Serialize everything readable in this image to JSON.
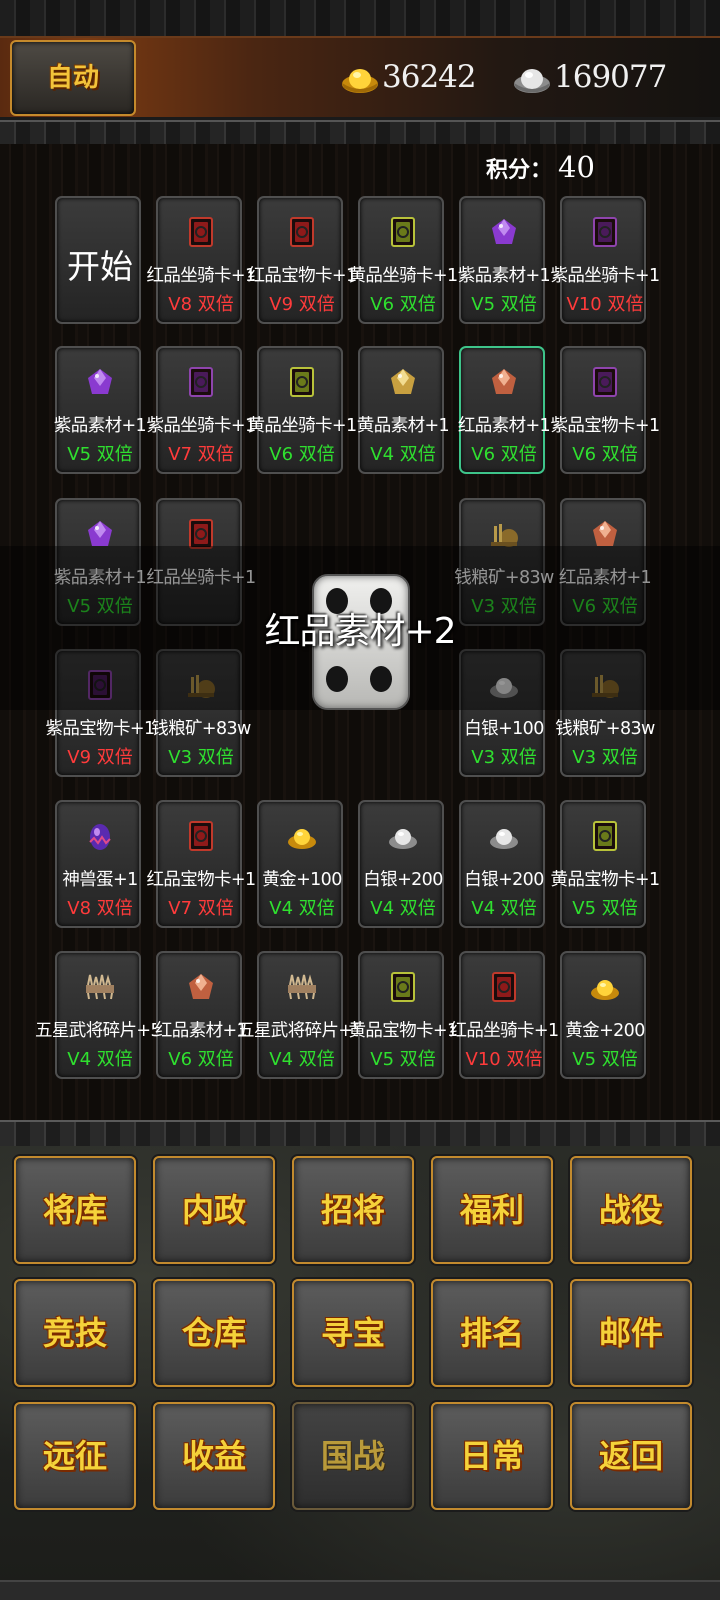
{
  "header": {
    "auto_label": "自动",
    "gold_amount": "36242",
    "silver_amount": "169077",
    "gold_icon": "gold-ingot-icon",
    "silver_icon": "silver-ingot-icon"
  },
  "score": {
    "label": "积分：",
    "value": "40"
  },
  "start_label": "开始",
  "cells": [
    {
      "name": "红品坐骑卡+1",
      "mult": "V8 双倍",
      "color": "#ff3b3b",
      "icon": "red-card"
    },
    {
      "name": "红品宝物卡+1",
      "mult": "V9 双倍",
      "color": "#ff3b3b",
      "icon": "red-card"
    },
    {
      "name": "黄品坐骑卡+1",
      "mult": "V6 双倍",
      "color": "#2fe02f",
      "icon": "yellow-card"
    },
    {
      "name": "紫品素材+1",
      "mult": "V5 双倍",
      "color": "#2fe02f",
      "icon": "purple-gem"
    },
    {
      "name": "紫品坐骑卡+1",
      "mult": "V10 双倍",
      "color": "#ff3b3b",
      "icon": "purple-card"
    },
    {
      "name": "紫品素材+1",
      "mult": "V5 双倍",
      "color": "#2fe02f",
      "icon": "purple-gem"
    },
    {
      "name": "紫品坐骑卡+1",
      "mult": "V7 双倍",
      "color": "#ff3b3b",
      "icon": "purple-card"
    },
    {
      "name": "黄品坐骑卡+1",
      "mult": "V6 双倍",
      "color": "#2fe02f",
      "icon": "yellow-card"
    },
    {
      "name": "黄品素材+1",
      "mult": "V4 双倍",
      "color": "#2fe02f",
      "icon": "yellow-gem"
    },
    {
      "name": "红品素材+1",
      "mult": "V6 双倍",
      "color": "#2fe02f",
      "icon": "red-gem",
      "selected": true
    },
    {
      "name": "紫品宝物卡+1",
      "mult": "V6 双倍",
      "color": "#2fe02f",
      "icon": "purple-card"
    },
    {
      "name": "紫品素材+1",
      "mult": "V5 双倍",
      "color": "#2fe02f",
      "icon": "purple-gem"
    },
    {
      "name": "红品坐骑卡+1",
      "mult": "",
      "color": "#ff3b3b",
      "icon": "red-card"
    },
    {
      "name": "钱粮矿+83w",
      "mult": "V3 双倍",
      "color": "#2fe02f",
      "icon": "grain"
    },
    {
      "name": "红品素材+1",
      "mult": "V6 双倍",
      "color": "#2fe02f",
      "icon": "red-gem"
    },
    {
      "name": "紫品宝物卡+1",
      "mult": "V9 双倍",
      "color": "#ff3b3b",
      "icon": "purple-card"
    },
    {
      "name": "钱粮矿+83w",
      "mult": "V3 双倍",
      "color": "#2fe02f",
      "icon": "grain"
    },
    {
      "name": "白银+100",
      "mult": "V3 双倍",
      "color": "#2fe02f",
      "icon": "silver"
    },
    {
      "name": "钱粮矿+83w",
      "mult": "V3 双倍",
      "color": "#2fe02f",
      "icon": "grain"
    },
    {
      "name": "神兽蛋+1",
      "mult": "V8 双倍",
      "color": "#ff3b3b",
      "icon": "egg"
    },
    {
      "name": "红品宝物卡+1",
      "mult": "V7 双倍",
      "color": "#ff3b3b",
      "icon": "red-card"
    },
    {
      "name": "黄金+100",
      "mult": "V4 双倍",
      "color": "#2fe02f",
      "icon": "gold"
    },
    {
      "name": "白银+200",
      "mult": "V4 双倍",
      "color": "#2fe02f",
      "icon": "silver"
    },
    {
      "name": "白银+200",
      "mult": "V4 双倍",
      "color": "#2fe02f",
      "icon": "silver"
    },
    {
      "name": "黄品宝物卡+1",
      "mult": "V5 双倍",
      "color": "#2fe02f",
      "icon": "yellow-card"
    },
    {
      "name": "五星武将碎片+50",
      "mult": "V4 双倍",
      "color": "#2fe02f",
      "icon": "shard"
    },
    {
      "name": "红品素材+1",
      "mult": "V6 双倍",
      "color": "#2fe02f",
      "icon": "red-gem"
    },
    {
      "name": "五星武将碎片+50",
      "mult": "V4 双倍",
      "color": "#2fe02f",
      "icon": "shard"
    },
    {
      "name": "黄品宝物卡+1",
      "mult": "V5 双倍",
      "color": "#2fe02f",
      "icon": "yellow-card"
    },
    {
      "name": "红品坐骑卡+1",
      "mult": "V10 双倍",
      "color": "#ff3b3b",
      "icon": "red-card"
    },
    {
      "name": "黄金+200",
      "mult": "V5 双倍",
      "color": "#2fe02f",
      "icon": "gold"
    }
  ],
  "roll": {
    "result_text": "红品素材+2",
    "dice_value": 4
  },
  "menu": [
    {
      "label": "将库"
    },
    {
      "label": "内政"
    },
    {
      "label": "招将"
    },
    {
      "label": "福利"
    },
    {
      "label": "战役"
    },
    {
      "label": "竞技"
    },
    {
      "label": "仓库"
    },
    {
      "label": "寻宝"
    },
    {
      "label": "排名"
    },
    {
      "label": "邮件"
    },
    {
      "label": "远征"
    },
    {
      "label": "收益"
    },
    {
      "label": "国战",
      "dim": true
    },
    {
      "label": "日常"
    },
    {
      "label": "返回"
    }
  ]
}
